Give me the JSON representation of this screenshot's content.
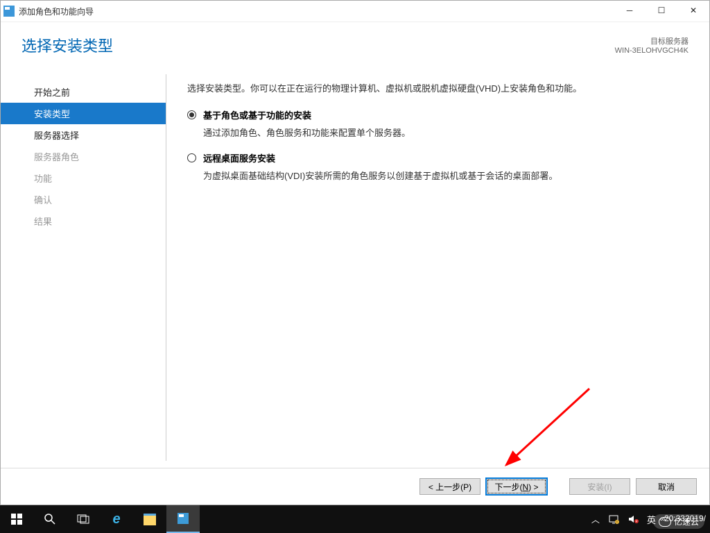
{
  "window": {
    "title": "添加角色和功能向导"
  },
  "header": {
    "page_title": "选择安装类型",
    "dest_label": "目标服务器",
    "dest_server": "WIN-3ELOHVGCH4K"
  },
  "sidebar": {
    "steps": [
      {
        "label": "开始之前",
        "state": "done"
      },
      {
        "label": "安装类型",
        "state": "active"
      },
      {
        "label": "服务器选择",
        "state": "done"
      },
      {
        "label": "服务器角色",
        "state": "disabled"
      },
      {
        "label": "功能",
        "state": "disabled"
      },
      {
        "label": "确认",
        "state": "disabled"
      },
      {
        "label": "结果",
        "state": "disabled"
      }
    ]
  },
  "content": {
    "intro": "选择安装类型。你可以在正在运行的物理计算机、虚拟机或脱机虚拟硬盘(VHD)上安装角色和功能。",
    "options": [
      {
        "title": "基于角色或基于功能的安装",
        "desc": "通过添加角色、角色服务和功能来配置单个服务器。",
        "selected": true
      },
      {
        "title": "远程桌面服务安装",
        "desc": "为虚拟桌面基础结构(VDI)安装所需的角色服务以创建基于虚拟机或基于会话的桌面部署。",
        "selected": false
      }
    ]
  },
  "footer": {
    "back": "< 上一步(P)",
    "next_pre": "下一步(",
    "next_u": "N",
    "next_post": ") >",
    "install": "安装(I)",
    "cancel": "取消"
  },
  "taskbar": {
    "ime": "英",
    "time": "20:33",
    "date": "2019/"
  },
  "watermark": "亿速云"
}
